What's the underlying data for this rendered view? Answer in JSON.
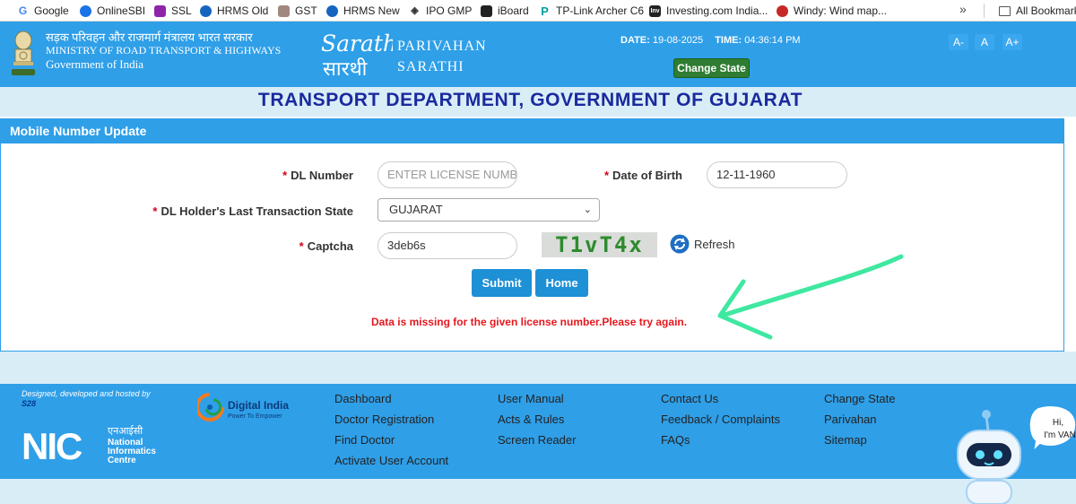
{
  "bookmarks": [
    {
      "label": "Google",
      "color": "#4285f4"
    },
    {
      "label": "OnlineSBI",
      "color": "#1a73e8"
    },
    {
      "label": "SSL",
      "color": "#8e24aa"
    },
    {
      "label": "HRMS Old",
      "color": "#1565c0"
    },
    {
      "label": "GST",
      "color": "#6d4c41"
    },
    {
      "label": "HRMS New",
      "color": "#1565c0"
    },
    {
      "label": "IPO GMP",
      "color": "#333333"
    },
    {
      "label": "iBoard",
      "color": "#222222"
    },
    {
      "label": "TP-Link Archer C6",
      "color": "#00a0a0"
    },
    {
      "label": "Investing.com India...",
      "color": "#222222"
    },
    {
      "label": "Windy: Wind map...",
      "color": "#c62828"
    }
  ],
  "bookmarks_more": "»",
  "all_bookmarks": "All Bookmarks",
  "header": {
    "ministry_hindi": "सड़क परिवहन और राजमार्ग मंत्रालय भारत सरकार",
    "ministry_en": "MINISTRY OF ROAD TRANSPORT & HIGHWAYS",
    "gov": "Government of India",
    "logo_word_en": "Sarathi",
    "logo_word_hi": "सारथी",
    "brand_line1": "PARIVAHAN",
    "brand_line2": "SARATHI",
    "date_label": "DATE:",
    "date_value": "19-08-2025",
    "time_label": "TIME:",
    "time_value": "04:36:14 PM",
    "change_state": "Change State",
    "font_small": "A-",
    "font_normal": "A",
    "font_large": "A+"
  },
  "dept_title": "TRANSPORT DEPARTMENT, GOVERNMENT OF GUJARAT",
  "form": {
    "panel_title": "Mobile Number Update",
    "required_mark": "*",
    "dl_label": "DL Number",
    "dl_placeholder": "ENTER LICENSE NUMBER",
    "dob_label": "Date of Birth",
    "dob_value": "12-11-1960",
    "state_label": "DL Holder's Last Transaction State",
    "state_value": "GUJARAT",
    "captcha_label": "Captcha",
    "captcha_value": "3deb6s",
    "captcha_image_text": "T1vT4x",
    "refresh_label": "Refresh",
    "submit": "Submit",
    "home": "Home",
    "error": "Data is missing for the given license number.Please try again."
  },
  "footer": {
    "credit_line": "Designed, developed and hosted by",
    "credit_org": "S28",
    "nic_hindi": "एनआईसी",
    "nic_line1": "National",
    "nic_line2": "Informatics",
    "nic_line3": "Centre",
    "digital_india": "Digital India",
    "digital_india_tag": "Power To Empower",
    "col1": [
      "Dashboard",
      "Doctor Registration",
      "Find Doctor",
      "Activate User Account"
    ],
    "col2": [
      "User Manual",
      "Acts & Rules",
      "Screen Reader"
    ],
    "col3": [
      "Contact Us",
      "Feedback / Complaints",
      "FAQs"
    ],
    "col4": [
      "Change State",
      "Parivahan",
      "Sitemap"
    ],
    "bot_greeting_1": "Hi,",
    "bot_greeting_2": "I'm VAN"
  },
  "colors": {
    "brand_blue": "#2f9fe8",
    "title_navy": "#1a2a9e",
    "error_red": "#e4181e",
    "annotation_green": "#3ee8a0"
  }
}
